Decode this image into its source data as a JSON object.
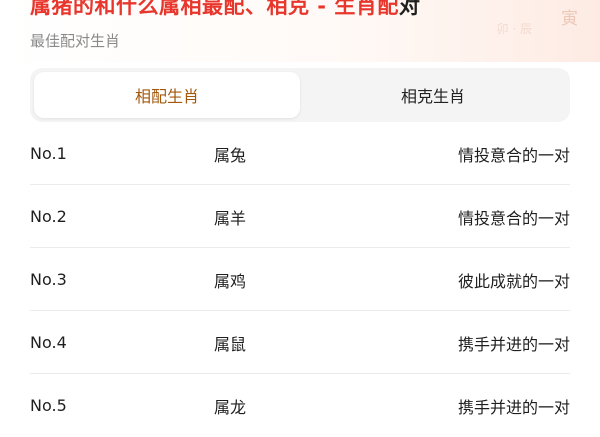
{
  "header": {
    "title_red_1": "属猪的和什么属相最配、相克",
    "title_dash": " - ",
    "title_red_2": "生肖配",
    "title_dark": "对",
    "subtitle": "最佳配对生肖",
    "deco_1": "寅",
    "deco_2": "卯 · 辰"
  },
  "tabs": [
    {
      "label": "相配生肖",
      "active": true
    },
    {
      "label": "相克生肖",
      "active": false
    }
  ],
  "rows": [
    {
      "rank": "No.1",
      "animal": "属兔",
      "desc": "情投意合的一对"
    },
    {
      "rank": "No.2",
      "animal": "属羊",
      "desc": "情投意合的一对"
    },
    {
      "rank": "No.3",
      "animal": "属鸡",
      "desc": "彼此成就的一对"
    },
    {
      "rank": "No.4",
      "animal": "属鼠",
      "desc": "携手并进的一对"
    },
    {
      "rank": "No.5",
      "animal": "属龙",
      "desc": "携手并进的一对"
    }
  ]
}
